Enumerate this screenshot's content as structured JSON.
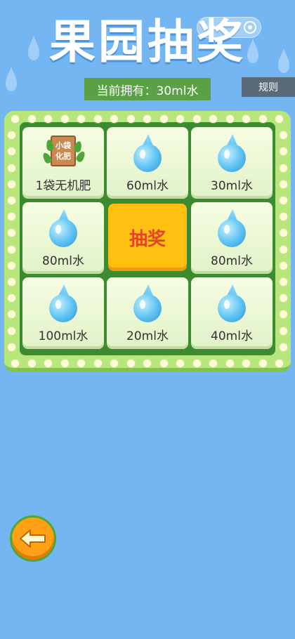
{
  "header": {
    "title": "果园抽奖",
    "capsule_more": "•••"
  },
  "holdings_text": "当前拥有：30ml水",
  "rules_label": "规则",
  "draw_label": "抽奖",
  "prizes": [
    {
      "label": "1袋无机肥",
      "icon": "fertilizer-bag-icon",
      "icon_text": "小袋化肥"
    },
    {
      "label": "60ml水",
      "icon": "water-drop-icon"
    },
    {
      "label": "30ml水",
      "icon": "water-drop-icon"
    },
    {
      "label": "80ml水",
      "icon": "water-drop-icon"
    },
    {
      "label": "80ml水",
      "icon": "water-drop-icon"
    },
    {
      "label": "100ml水",
      "icon": "water-drop-icon"
    },
    {
      "label": "20ml水",
      "icon": "water-drop-icon"
    },
    {
      "label": "40ml水",
      "icon": "water-drop-icon"
    }
  ],
  "fertilizer_icon_lines": [
    "小袋",
    "化肥"
  ],
  "colors": {
    "background": "#74b6f2",
    "board": "#b6e67c",
    "board_inner": "#3c8b30",
    "draw_button": "#ffc012",
    "draw_text": "#e64428",
    "holdings_bg": "#5aa044",
    "back_button": "#ffa015"
  }
}
